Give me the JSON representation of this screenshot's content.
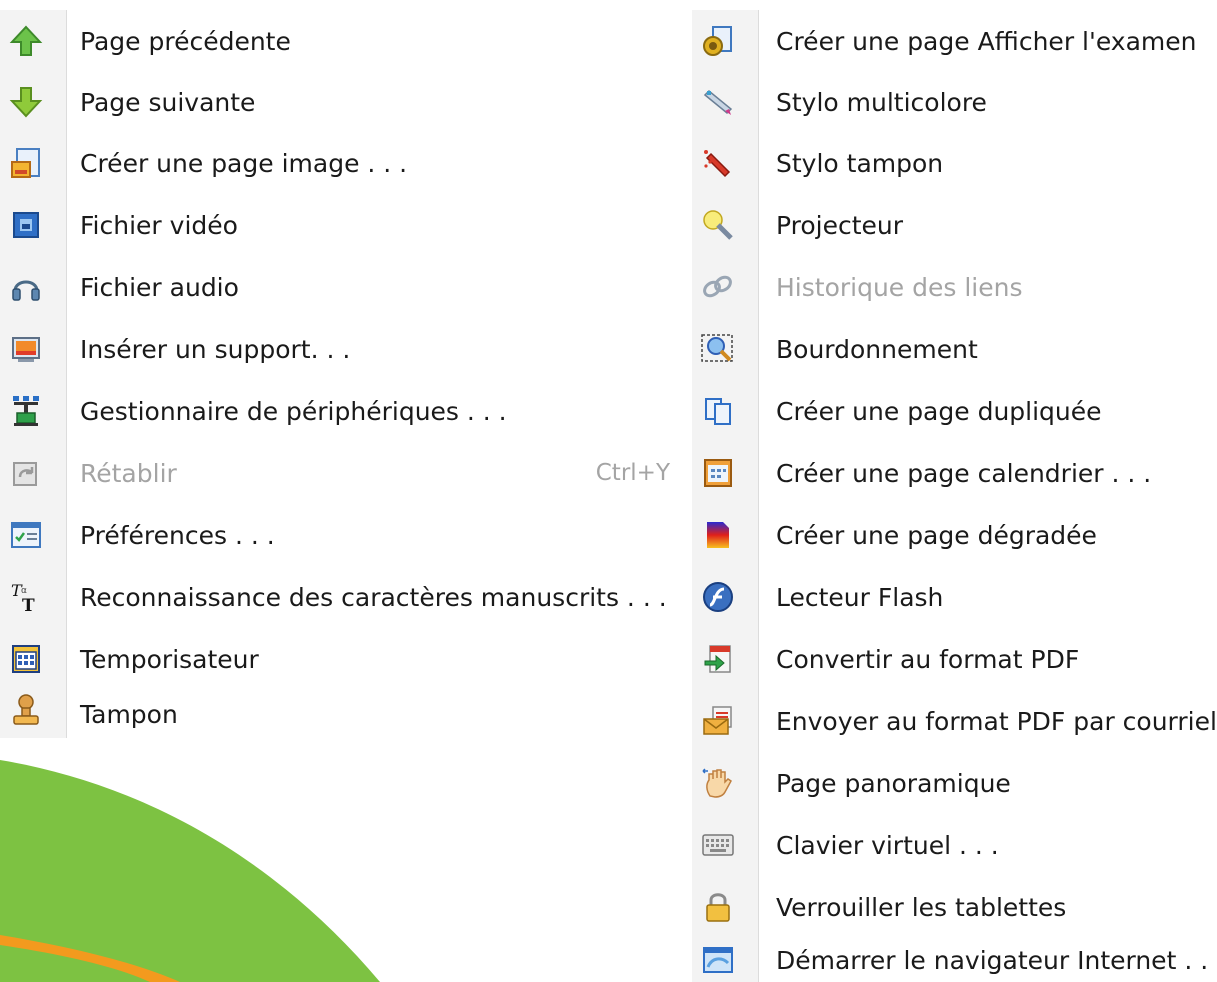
{
  "left_menu": {
    "items": [
      {
        "label": "Page précédente",
        "icon": "arrow-up-icon"
      },
      {
        "label": "Page suivante",
        "icon": "arrow-down-icon"
      },
      {
        "label": "Créer une page image . . .",
        "icon": "image-page-icon"
      },
      {
        "label": "Fichier vidéo",
        "icon": "video-file-icon"
      },
      {
        "label": "Fichier audio",
        "icon": "headphones-icon"
      },
      {
        "label": "Insérer un support. . .",
        "icon": "media-support-icon"
      },
      {
        "label": "Gestionnaire de périphériques . . .",
        "icon": "device-manager-icon"
      },
      {
        "label": "Rétablir",
        "icon": "redo-icon",
        "shortcut": "Ctrl+Y",
        "disabled": true
      },
      {
        "label": "Préférences . . .",
        "icon": "preferences-icon"
      },
      {
        "label": "Reconnaissance des caractères manuscrits . . .",
        "icon": "handwriting-icon"
      },
      {
        "label": "Temporisateur",
        "icon": "timer-icon"
      },
      {
        "label": "Tampon",
        "icon": "stamp-icon"
      }
    ]
  },
  "right_menu": {
    "items": [
      {
        "label": "Créer une page Afficher l'examen",
        "icon": "exam-page-icon"
      },
      {
        "label": "Stylo multicolore",
        "icon": "multicolor-pen-icon"
      },
      {
        "label": "Stylo tampon",
        "icon": "stamp-pen-icon"
      },
      {
        "label": "Projecteur",
        "icon": "spotlight-icon"
      },
      {
        "label": "Historique des liens",
        "icon": "link-history-icon",
        "disabled": true
      },
      {
        "label": "Bourdonnement",
        "icon": "zoom-icon"
      },
      {
        "label": "Créer une page dupliquée",
        "icon": "duplicate-page-icon"
      },
      {
        "label": "Créer une page calendrier . . .",
        "icon": "calendar-page-icon"
      },
      {
        "label": "Créer une page dégradée",
        "icon": "gradient-page-icon"
      },
      {
        "label": "Lecteur Flash",
        "icon": "flash-player-icon"
      },
      {
        "label": "Convertir au format PDF",
        "icon": "convert-pdf-icon"
      },
      {
        "label": "Envoyer au format PDF par courriel",
        "icon": "email-pdf-icon"
      },
      {
        "label": "Page panoramique",
        "icon": "pan-hand-icon"
      },
      {
        "label": "Clavier virtuel . . .",
        "icon": "virtual-keyboard-icon"
      },
      {
        "label": "Verrouiller les tablettes",
        "icon": "lock-icon"
      },
      {
        "label": "Démarrer le navigateur Internet . . .",
        "icon": "browser-icon"
      }
    ]
  },
  "colors": {
    "swoosh_green": "#7dc242",
    "swoosh_orange": "#f39a1e",
    "disabled_text": "#a4a4a4"
  }
}
